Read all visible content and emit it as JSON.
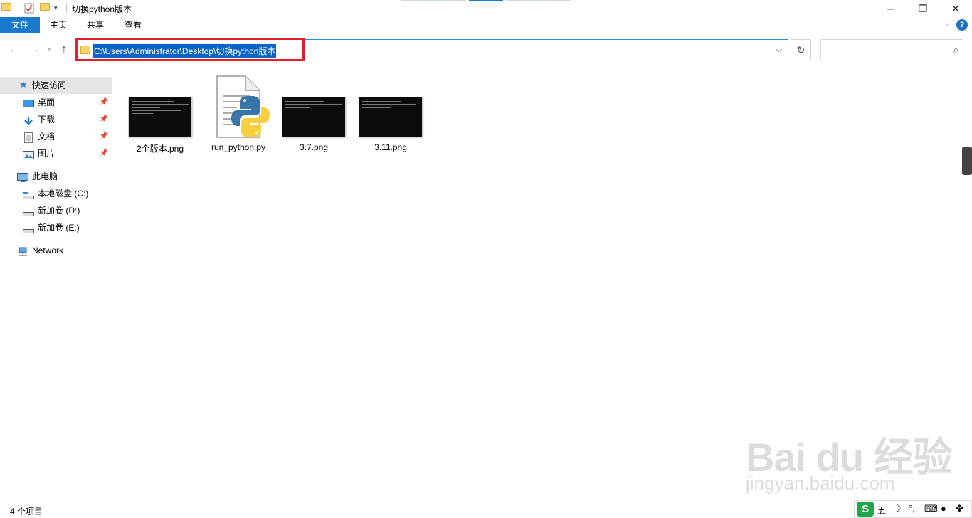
{
  "window": {
    "title": "切换python版本",
    "controls": {
      "minimize": "─",
      "maximize": "❐",
      "close": "✕"
    }
  },
  "ribbon": {
    "tabs": [
      "文件",
      "主页",
      "共享",
      "查看"
    ],
    "help": "?"
  },
  "navigation": {
    "address_path": "C:\\Users\\Administrator\\Desktop\\切换python版本",
    "search_placeholder": ""
  },
  "sidebar": {
    "quick_access": {
      "label": "快速访问",
      "icon": "star-icon"
    },
    "pinned": [
      {
        "label": "桌面",
        "icon": "desktop-icon"
      },
      {
        "label": "下载",
        "icon": "download-icon"
      },
      {
        "label": "文档",
        "icon": "document-icon"
      },
      {
        "label": "图片",
        "icon": "pictures-icon"
      }
    ],
    "this_pc": {
      "label": "此电脑",
      "icon": "computer-icon"
    },
    "drives": [
      {
        "label": "本地磁盘 (C:)",
        "icon": "drive-icon"
      },
      {
        "label": "新加卷 (D:)",
        "icon": "drive-icon"
      },
      {
        "label": "新加卷 (E:)",
        "icon": "drive-icon"
      }
    ],
    "network": {
      "label": "Network",
      "icon": "network-icon"
    }
  },
  "files": [
    {
      "name": "2个版本.png",
      "type": "image"
    },
    {
      "name": "run_python.py",
      "type": "python"
    },
    {
      "name": "3.7.png",
      "type": "image"
    },
    {
      "name": "3.11.png",
      "type": "image"
    }
  ],
  "status": {
    "item_count": "4 个项目"
  },
  "ime": {
    "mode": "五"
  },
  "watermark": {
    "brand": "Bai du 经验",
    "url": "jingyan.baidu.com"
  },
  "colors": {
    "accent": "#1979ca",
    "highlight": "#e0202a",
    "selection": "#0a64c8"
  }
}
